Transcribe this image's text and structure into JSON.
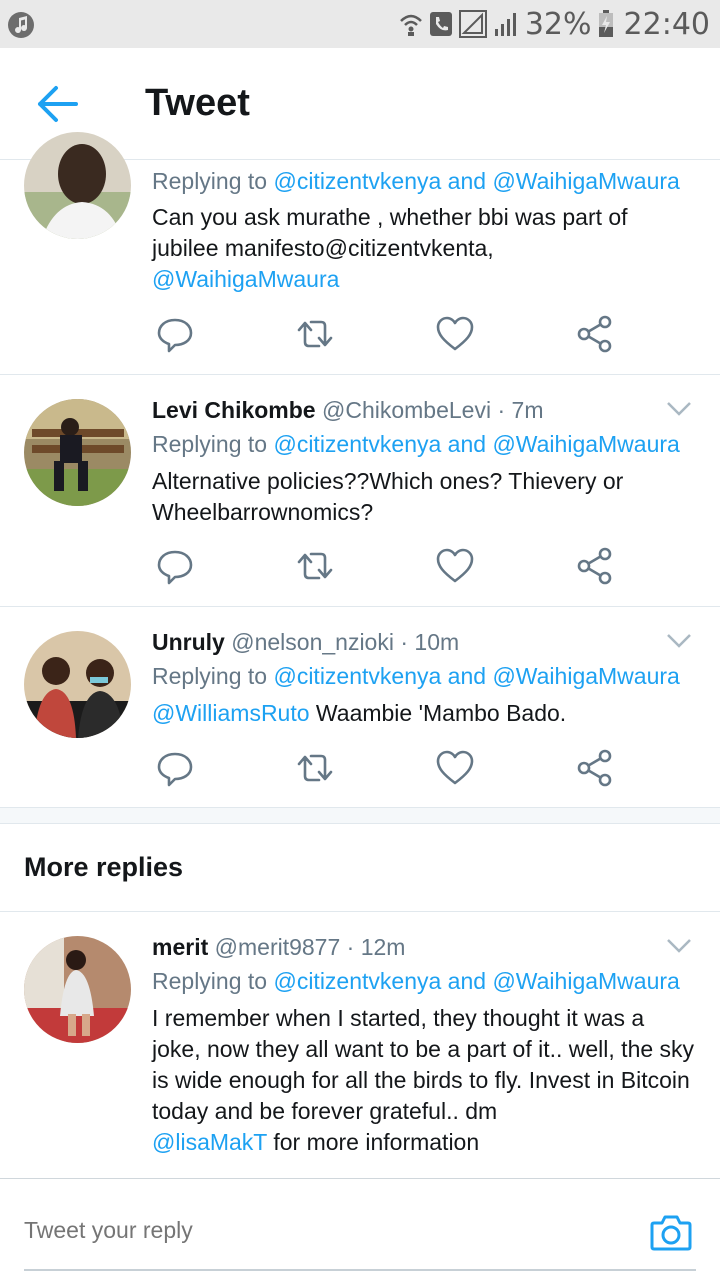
{
  "status_bar": {
    "battery": "32%",
    "time": "22:40"
  },
  "header": {
    "title": "Tweet",
    "back_icon": "arrow-left-icon"
  },
  "tweets": [
    {
      "name": "",
      "handle": "",
      "time": "",
      "replying_prefix": "Replying to ",
      "replying_to_1": "@citizentvkenya",
      "replying_and": " and ",
      "replying_to_2": "@WaihigaMwaura",
      "text_line1": "Can you ask murathe , whether bbi was part of jubilee manifesto@citizentvkenta,",
      "text_mention": "@WaihigaMwaura"
    },
    {
      "name": "Levi Chikombe",
      "handle": "@ChikombeLevi",
      "sep": " · ",
      "time": "7m",
      "replying_prefix": "Replying to ",
      "replying_to_1": "@citizentvkenya",
      "replying_and": " and ",
      "replying_to_2": "@WaihigaMwaura",
      "text": "Alternative policies??Which ones? Thievery or Wheelbarrownomics?"
    },
    {
      "name": "Unruly",
      "handle": "@nelson_nzioki",
      "sep": " · ",
      "time": "10m",
      "replying_prefix": "Replying to ",
      "replying_to_1": "@citizentvkenya",
      "replying_and": " and ",
      "replying_to_2": "@WaihigaMwaura",
      "text_mention": "@WilliamsRuto",
      "text": " Waambie 'Mambo Bado."
    }
  ],
  "more_replies": {
    "title": "More replies",
    "tweet": {
      "name": "merit",
      "handle": "@merit9877",
      "sep": " · ",
      "time": "12m",
      "replying_prefix": "Replying to ",
      "replying_to_1": "@citizentvkenya",
      "replying_and": " and ",
      "replying_to_2": "@WaihigaMwaura",
      "text": "I remember when I started, they thought it was a joke, now they all want to be a part of it.. well, the sky is wide enough for all the birds to fly.  Invest in Bitcoin today and be forever grateful.. dm",
      "text_mention": "@lisaMakT",
      "text_after": " for more information"
    }
  },
  "composer": {
    "placeholder": "Tweet your reply",
    "camera_icon": "camera-icon"
  },
  "colors": {
    "accent": "#1da1f2",
    "muted": "#657786",
    "text": "#14171a"
  }
}
